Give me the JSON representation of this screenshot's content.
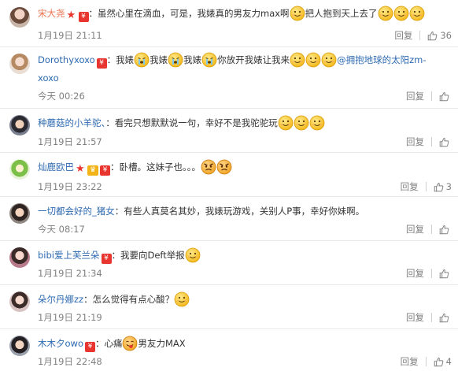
{
  "comments": [
    {
      "user": "宋大尧",
      "badges": [
        "star",
        "red"
      ],
      "text_a": "：虽然心里在滴血，可是，我婊真的男友力max啊",
      "text_b": "把人抱到天上去了",
      "time": "1月19日 21:11",
      "reply": "回复",
      "likes": "36"
    },
    {
      "user": "Dorothyxoxo",
      "badges": [
        "red"
      ],
      "text_a": "：我婊",
      "text_b": "我婊",
      "text_c": "我婊",
      "text_d": "你放开我婊让我来",
      "mention": "@拥抱地球的太阳zm-",
      "line2": "xoxo",
      "time": "今天 00:26",
      "reply": "回复",
      "likes": ""
    },
    {
      "user": "种蘑菇的小羊驼、",
      "badges": [],
      "text_a": "：看完只想默默说一句，幸好不是我驼驼玩",
      "time": "1月19日 21:57",
      "reply": "回复",
      "likes": ""
    },
    {
      "user": "灿鹿欧巴",
      "badges": [
        "star",
        "gold",
        "red"
      ],
      "text_a": "：卧槽。这妹子也。。。",
      "time": "1月19日 23:22",
      "reply": "回复",
      "likes": "3"
    },
    {
      "user": "一切都会好的_猪女",
      "badges": [],
      "text_a": "：有些人真莫名其妙，我婊玩游戏，关别人P事，幸好你妹啊。",
      "time": "今天 08:17",
      "reply": "回复",
      "likes": ""
    },
    {
      "user": "bibi爱上芙兰朵",
      "badges": [
        "red"
      ],
      "text_a": "：我要向Deft举报",
      "time": "1月19日 21:34",
      "reply": "回复",
      "likes": ""
    },
    {
      "user": "朵尔丹娜zz",
      "badges": [],
      "text_a": "：怎么觉得有点心酸？",
      "time": "1月19日 21:19",
      "reply": "回复",
      "likes": ""
    },
    {
      "user": "木木夕owo",
      "badges": [
        "red"
      ],
      "text_a": "：心痛",
      "text_b": "男友力MAX",
      "time": "1月19日 22:48",
      "reply": "回复",
      "likes": "4"
    }
  ],
  "colors": {
    "username": "#eb7350",
    "link": "#2e6ab1",
    "meta": "#808080",
    "badge_red": "#e8352f",
    "badge_gold": "#f3b418"
  },
  "icons": {
    "like": "thumbs-up-icon",
    "emoji_smile": "smile-emoji-icon",
    "emoji_cry": "cry-emoji-icon",
    "emoji_angry": "angry-emoji-icon",
    "emoji_tongue": "tongue-emoji-icon"
  }
}
